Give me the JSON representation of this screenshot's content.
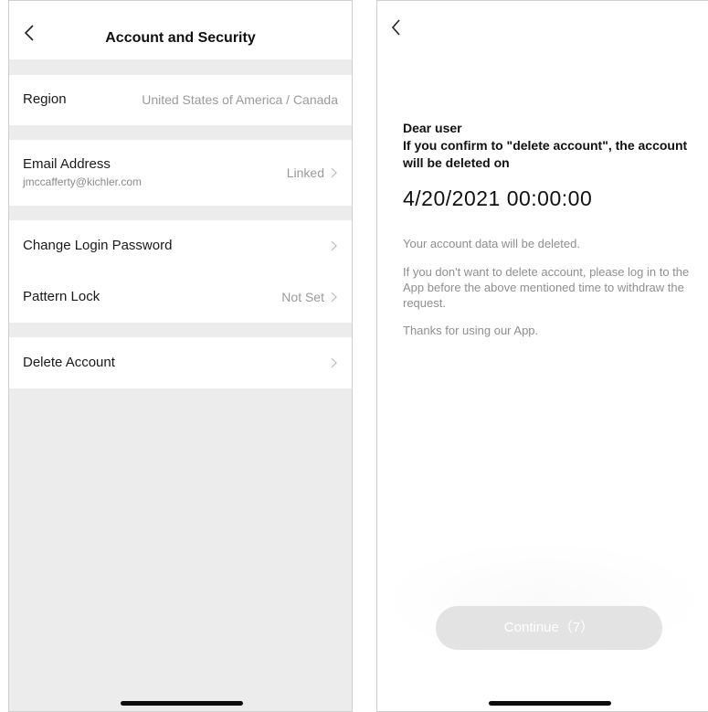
{
  "left_screen": {
    "header": {
      "title": "Account and Security",
      "back_icon": "chevron-left-icon"
    },
    "rows": {
      "region": {
        "label": "Region",
        "value": "United States of America / Canada"
      },
      "email": {
        "label": "Email Address",
        "sublabel": "jmccafferty@kichler.com",
        "value": "Linked"
      },
      "change_password": {
        "label": "Change Login Password",
        "value": ""
      },
      "pattern_lock": {
        "label": "Pattern Lock",
        "value": "Not Set"
      },
      "delete_account": {
        "label": "Delete Account",
        "value": ""
      }
    }
  },
  "right_screen": {
    "back_icon": "chevron-left-icon",
    "greeting": "Dear user",
    "confirm_text": "If you confirm to \"delete account\", the account will be deleted on",
    "deletion_date": "4/20/2021 00:00:00",
    "info": [
      "Your account data will be deleted.",
      "If you don't want to delete account, please log in to the App before the above mentioned time to withdraw the request.",
      "Thanks for using our App."
    ],
    "continue_button": "Continue（7）"
  },
  "colors": {
    "background_gray": "#ececec",
    "disabled_button": "#e3e3e3",
    "secondary_text": "#9a9a9a"
  }
}
